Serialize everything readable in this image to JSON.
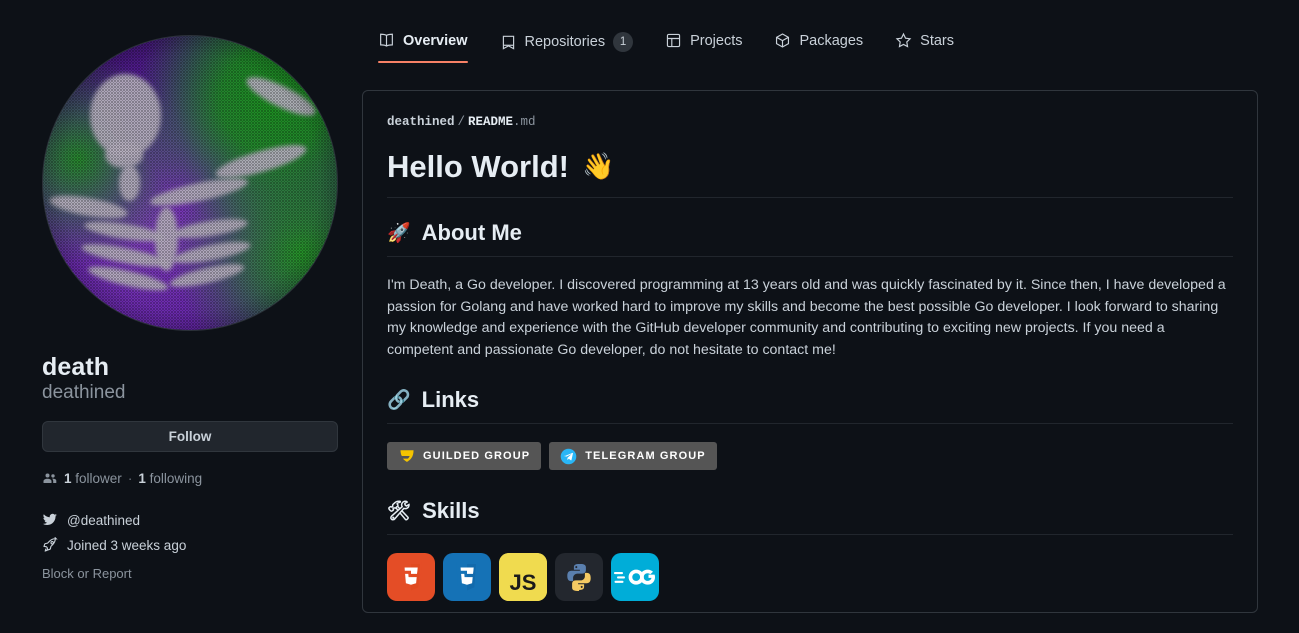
{
  "nav": {
    "tabs": [
      {
        "label": "Overview",
        "icon": "book-icon",
        "active": true,
        "count": null
      },
      {
        "label": "Repositories",
        "icon": "repo-icon",
        "active": false,
        "count": "1"
      },
      {
        "label": "Projects",
        "icon": "table-icon",
        "active": false,
        "count": null
      },
      {
        "label": "Packages",
        "icon": "package-icon",
        "active": false,
        "count": null
      },
      {
        "label": "Stars",
        "icon": "star-icon",
        "active": false,
        "count": null
      }
    ],
    "active_underline_color": "#f78166"
  },
  "profile": {
    "avatar_alt": "halftone skeleton avatar",
    "name": "death",
    "login": "deathined",
    "follow_label": "Follow",
    "followers_count": "1",
    "followers_label": "follower",
    "separator": "·",
    "following_count": "1",
    "following_label": "following",
    "twitter_handle": "@deathined",
    "joined": "Joined 3 weeks ago",
    "block_or_report": "Block or Report"
  },
  "readme": {
    "breadcrumb": {
      "owner": "deathined",
      "slash": "/",
      "file": "README",
      "ext": ".md"
    },
    "title": "Hello World!",
    "title_emoji": "👋",
    "sections": {
      "about": {
        "emoji": "🚀",
        "heading": "About Me",
        "body": "I'm Death, a Go developer. I discovered programming at 13 years old and was quickly fascinated by it. Since then, I have developed a passion for Golang and have worked hard to improve my skills and become the best possible Go developer. I look forward to sharing my knowledge and experience with the GitHub developer community and contributing to exciting new projects. If you need a competent and passionate Go developer, do not hesitate to contact me!"
      },
      "links": {
        "emoji": "🔗",
        "heading": "Links",
        "badges": [
          {
            "label": "GUILDED GROUP",
            "icon": "guilded-icon",
            "bg": "#555555",
            "icon_color": "#f5c400"
          },
          {
            "label": "TELEGRAM GROUP",
            "icon": "telegram-icon",
            "bg": "#555555",
            "icon_color": "#29b6f6"
          }
        ]
      },
      "skills": {
        "emoji": "🛠",
        "heading": "Skills",
        "items": [
          {
            "name": "html5-icon",
            "label": "HTML5",
            "bg": "#e44d26"
          },
          {
            "name": "css3-icon",
            "label": "CSS3",
            "bg": "#1572b6"
          },
          {
            "name": "javascript-icon",
            "label": "JavaScript",
            "bg": "#f0db4f"
          },
          {
            "name": "python-icon",
            "label": "Python",
            "bg": "#23272e"
          },
          {
            "name": "go-icon",
            "label": "Go",
            "bg": "#00add8"
          }
        ]
      }
    }
  },
  "theme": {
    "page_bg": "#0d1117",
    "card_border": "#30363d",
    "text_primary": "#c9d1d9",
    "text_muted": "#8b949e",
    "accent": "#f78166"
  }
}
